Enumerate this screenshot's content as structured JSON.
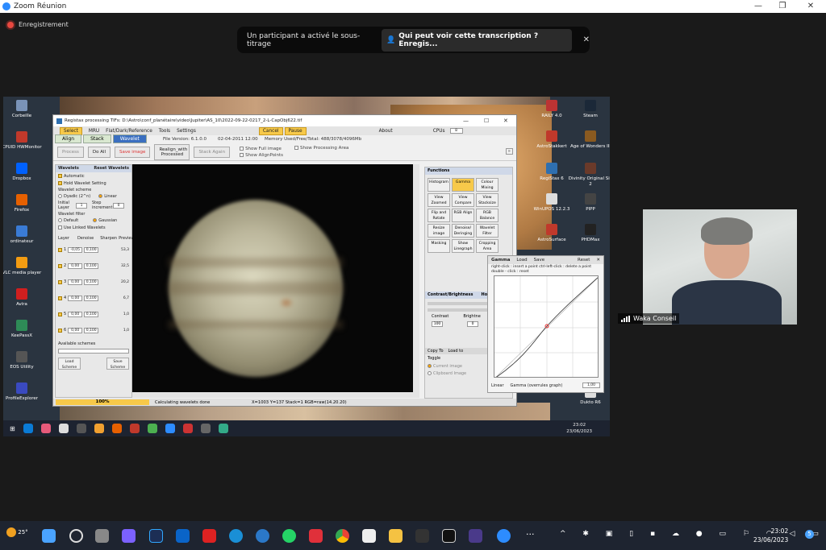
{
  "zoom": {
    "title": "Zoom Réunion",
    "recording": "Enregistrement",
    "notification": "Un participant a activé le sous-titrage",
    "notification_button": "Qui peut voir cette transcription ? Enregis...",
    "participant_name": "Waka Conseil"
  },
  "desktop_icons": [
    {
      "label": "Corbeille",
      "color": "#7a93b8"
    },
    {
      "label": "CPUID HWMonitor",
      "color": "#c0392b"
    },
    {
      "label": "Dropbox",
      "color": "#0061fe"
    },
    {
      "label": "Firefox",
      "color": "#e66000"
    },
    {
      "label": "ordinateur",
      "color": "#3a7bd5"
    },
    {
      "label": "VLC media player",
      "color": "#f39c12"
    },
    {
      "label": "Avira",
      "color": "#d01f1f"
    },
    {
      "label": "KeePassX",
      "color": "#2e8b57"
    },
    {
      "label": "EOS Utility",
      "color": "#555"
    },
    {
      "label": "ProfileExplorer",
      "color": "#3a4ac0"
    }
  ],
  "desktop_icons_right": [
    {
      "label": "RAILY 4.0",
      "color": "#b33"
    },
    {
      "label": "Steam",
      "color": "#1b2838"
    },
    {
      "label": "AstroStakkert",
      "color": "#c0392b"
    },
    {
      "label": "Age of Wonders III",
      "color": "#8a5a20"
    },
    {
      "label": "RegiStax 6",
      "color": "#2e6fb0"
    },
    {
      "label": "Divinity Original Sin 2",
      "color": "#6a3a2a"
    },
    {
      "label": "WinUPOS 12.2.3",
      "color": "#ddd"
    },
    {
      "label": "PIPP",
      "color": "#444"
    },
    {
      "label": "AstroSurface",
      "color": "#c0392b"
    },
    {
      "label": "PHDMax",
      "color": "#222"
    },
    {
      "label": "Dukto R6",
      "color": "#ddd"
    }
  ],
  "registax": {
    "title": "Registax processing TIFs: D:\\Astro\\conf_planétaire\\video\\Jupiter\\AS_10\\2022-09-22-0217_2-L-CapObj622.tif",
    "menu": [
      "Select",
      "MRU",
      "Flat/Dark/Reference",
      "Tools",
      "Settings",
      "Cancel",
      "Pause",
      "About",
      "CPUs"
    ],
    "cpus": "8",
    "tabs": [
      "Align",
      "Stack",
      "Wavelet"
    ],
    "file_version": "File Version: 6.1.0.0",
    "date": "02-04-2011 12:00",
    "memory": "Memory Used/Free/Total: 488/3078/4096Mb",
    "toolbar": [
      "Process",
      "Do All",
      "Save image",
      "Realign_with Processed",
      "Stack Again",
      "Show Full image",
      "Show Processing Area",
      "Show AlignPoints"
    ],
    "wavelets": {
      "header": "Wavelets",
      "reset": "Reset Wavelets",
      "automatic": "Automatic",
      "hold": "Hold Wavelet Setting",
      "scheme_label": "Wavelet scheme",
      "dyadic": "Dyadic (2^n)",
      "linear": "Linear",
      "initial_layer_label": "Initial Layer",
      "initial_layer": "1",
      "step_label": "Step increment",
      "step": "0",
      "filter_label": "Wavelet filter",
      "default": "Default",
      "gaussian": "Gaussian",
      "linked": "Use Linked Wavelets",
      "layer": "Layer",
      "denoise": "Denoise",
      "sharpen": "Sharpen",
      "preview": "Preview",
      "layers": [
        {
          "n": "1",
          "d": "-0,05",
          "s": "0,100",
          "p": "53,3"
        },
        {
          "n": "2",
          "d": "0,00",
          "s": "0,100",
          "p": "32,5"
        },
        {
          "n": "3",
          "d": "0,00",
          "s": "0,100",
          "p": "20,2"
        },
        {
          "n": "4",
          "d": "0,00",
          "s": "0,100",
          "p": "6,7"
        },
        {
          "n": "5",
          "d": "0,00",
          "s": "0,100",
          "p": "1,0"
        },
        {
          "n": "6",
          "d": "0,00",
          "s": "0,100",
          "p": "1,0"
        }
      ],
      "available": "Available schemes",
      "load": "Load Scheme",
      "save": "Save Scheme"
    },
    "functions": {
      "header": "Functions",
      "buttons": [
        "Histogram",
        "Gamma",
        "Colour Mixing",
        "View Zoomed",
        "View Compare",
        "View Stacksize",
        "Flip and Rotate",
        "RGB Align",
        "RGB Balance",
        "Resize image",
        "Denoise/ Deringing",
        "Wavelet Filter",
        "Masking",
        "Show Linegraph",
        "Cropping Area"
      ],
      "contrast_header": "Contrast/Brightness",
      "hold": "Hold",
      "contrast": "Contrast",
      "contrast_val": "100",
      "brightness": "Brightne",
      "brightness_val": "0",
      "copy_to": "Copy To",
      "load_to": "Load to",
      "toggle": "Toggle",
      "current": "Current image",
      "clipboard": "Clipboard Image"
    },
    "status": {
      "progress": "100%",
      "progress_value": 1.0,
      "msg": "Calculating wavelets done",
      "coords": "X=1003 Y=137 Stack=1 RGB=raw(14.20.20)"
    }
  },
  "gamma": {
    "title": "Gamma",
    "load": "Load",
    "save": "Save",
    "reset": "Reset",
    "help1": "right-click : insert a point   ctrl-left-click : delete a point",
    "help2": "double - click : reset",
    "linear": "Linear",
    "overrules": "Gamma (overrules graph)",
    "value": "1,00"
  },
  "inner_clock": {
    "time": "23:02",
    "date": "23/06/2023"
  },
  "taskbar": {
    "temp": "25°",
    "time": "23:02",
    "date": "23/06/2023",
    "badge": "5"
  }
}
